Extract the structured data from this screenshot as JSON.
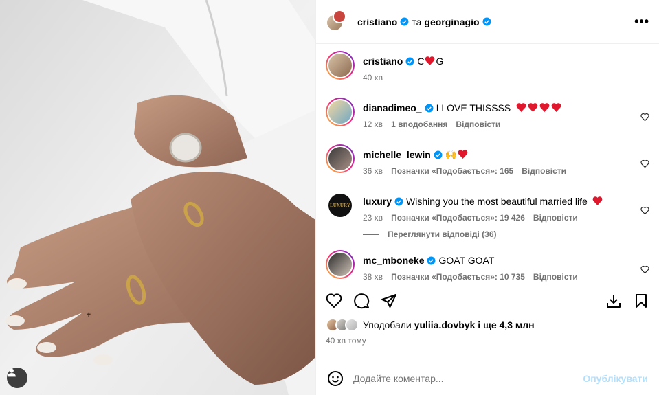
{
  "post": {
    "author": "cristiano",
    "connector": "та",
    "coauthor": "georginagio"
  },
  "comments": [
    {
      "user": "cristiano",
      "text_before": "C",
      "text_after": "G",
      "time": "40 хв"
    },
    {
      "user": "dianadimeo_",
      "text": "I LOVE THISSSS",
      "time": "12 хв",
      "likes": "1 вподобання",
      "reply": "Відповісти"
    },
    {
      "user": "michelle_lewin",
      "text": "🙌",
      "time": "36 хв",
      "likes": "Позначки «Подобається»: 165",
      "reply": "Відповісти"
    },
    {
      "user": "luxury",
      "text": "Wishing you the most beautiful married life",
      "time": "23 хв",
      "likes": "Позначки «Подобається»: 19 426",
      "reply": "Відповісти"
    },
    {
      "user": "mc_mboneke",
      "text": "GOAT GOAT",
      "time": "38 хв",
      "likes": "Позначки «Подобається»: 10 735",
      "reply": "Відповісти"
    }
  ],
  "replies_toggle": "Переглянути відповіді (36)",
  "liked_by": {
    "prefix": "Уподобали",
    "user": "yuliia.dovbyk",
    "suffix": "і ще 4,3 млн"
  },
  "post_time": "40 хв тому",
  "add_comment": {
    "placeholder": "Додайте коментар...",
    "publish": "Опублікувати"
  },
  "colors": {
    "verified": "#0095f6",
    "heart": "#ff3040",
    "publish_disabled": "#b2dffc",
    "meta": "#737373"
  },
  "luxury_logo_text": "LUXURY"
}
